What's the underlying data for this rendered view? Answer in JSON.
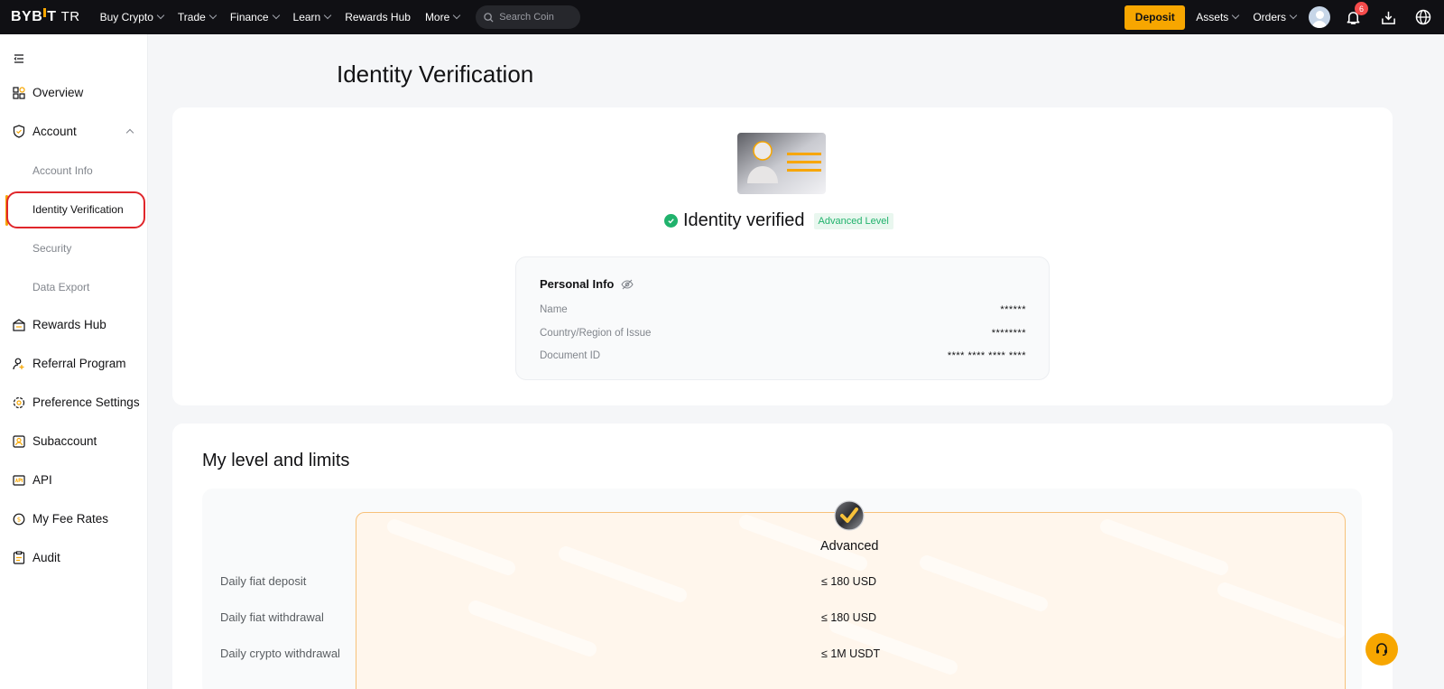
{
  "topbar": {
    "logo": {
      "text_left": "BYB",
      "text_right": "T",
      "suffix": "TR"
    },
    "nav": [
      {
        "label": "Buy Crypto",
        "dropdown": true
      },
      {
        "label": "Trade",
        "dropdown": true
      },
      {
        "label": "Finance",
        "dropdown": true
      },
      {
        "label": "Learn",
        "dropdown": true
      },
      {
        "label": "Rewards Hub",
        "dropdown": false
      },
      {
        "label": "More",
        "dropdown": true
      }
    ],
    "search_placeholder": "Search Coin",
    "deposit_label": "Deposit",
    "assets_label": "Assets",
    "orders_label": "Orders",
    "notification_count": "6",
    "accent_color": "#f7a600"
  },
  "sidebar": {
    "items": [
      {
        "label": "Overview",
        "icon": "grid-icon"
      },
      {
        "label": "Account",
        "icon": "shield-icon"
      },
      {
        "label": "Rewards Hub",
        "icon": "gift-icon"
      },
      {
        "label": "Referral Program",
        "icon": "user-plus-icon"
      },
      {
        "label": "Preference Settings",
        "icon": "gear-icon"
      },
      {
        "label": "Subaccount",
        "icon": "user-square-icon"
      },
      {
        "label": "API",
        "icon": "api-icon"
      },
      {
        "label": "My Fee Rates",
        "icon": "coin-icon"
      },
      {
        "label": "Audit",
        "icon": "clipboard-icon"
      }
    ],
    "account_sub": [
      {
        "label": "Account Info"
      },
      {
        "label": "Identity Verification",
        "active": true
      },
      {
        "label": "Security"
      },
      {
        "label": "Data Export"
      }
    ]
  },
  "main": {
    "title": "Identity Verification",
    "status": "Identity verified",
    "level_tag": "Advanced Level",
    "personal_info": {
      "title": "Personal Info",
      "rows": [
        {
          "label": "Name",
          "value": "******"
        },
        {
          "label": "Country/Region of Issue",
          "value": "********"
        },
        {
          "label": "Document ID",
          "value": "**** **** **** ****"
        }
      ]
    },
    "limits": {
      "title": "My level and limits",
      "level": "Advanced",
      "rows": [
        {
          "label": "Daily fiat deposit",
          "value": "≤ 180 USD"
        },
        {
          "label": "Daily fiat withdrawal",
          "value": "≤ 180 USD"
        },
        {
          "label": "Daily crypto withdrawal",
          "value": "≤ 1M USDT"
        }
      ]
    }
  }
}
